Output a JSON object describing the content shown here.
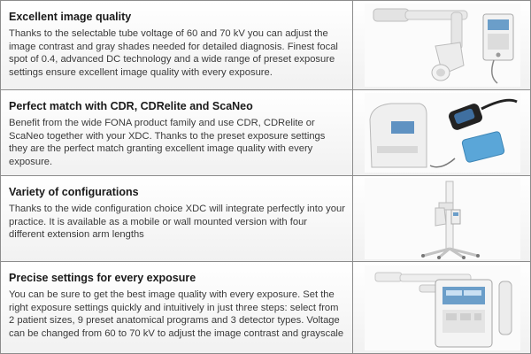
{
  "rows": [
    {
      "heading": "Excellent image quality",
      "body": "Thanks to the selectable tube voltage of 60 and 70 kV you can adjust the image contrast and gray shades needed for detailed diagnosis. Finest focal spot of 0.4, advanced DC technology and a wide range of preset exposure settings ensure excellent image quality with every exposure.",
      "image": "wall-mounted-xray-unit"
    },
    {
      "heading": "Perfect match with CDR, CDRelite and ScaNeo",
      "body": "Benefit from the wide FONA product family and use CDR, CDRelite or ScaNeo together with your XDC. Thanks to the preset exposure settings they are the perfect match granting excellent image quality with every exposure.",
      "image": "sensor-and-scanner-products"
    },
    {
      "heading": "Variety of configurations",
      "body": "Thanks to the wide configuration choice XDC will integrate perfectly into your practice. It is available as a mobile or wall mounted version with four different extension arm lengths",
      "image": "mobile-xray-stand"
    },
    {
      "heading": "Precise settings for every exposure",
      "body": "You can be sure to get the best image quality with every exposure. Set the right exposure settings quickly and intuitively in just three steps: select from 2 patient sizes, 9 preset anatomical programs and 3 detector types. Voltage can be changed from 60 to 70 kV to adjust the image contrast and grayscale",
      "image": "control-panel"
    }
  ],
  "colors": {
    "heading": "#1a1a1a",
    "body": "#3a3a3a",
    "border": "#8c8c8c",
    "panel_blue": "#6b9ec9",
    "sensor_blue": "#5aa6d8"
  }
}
